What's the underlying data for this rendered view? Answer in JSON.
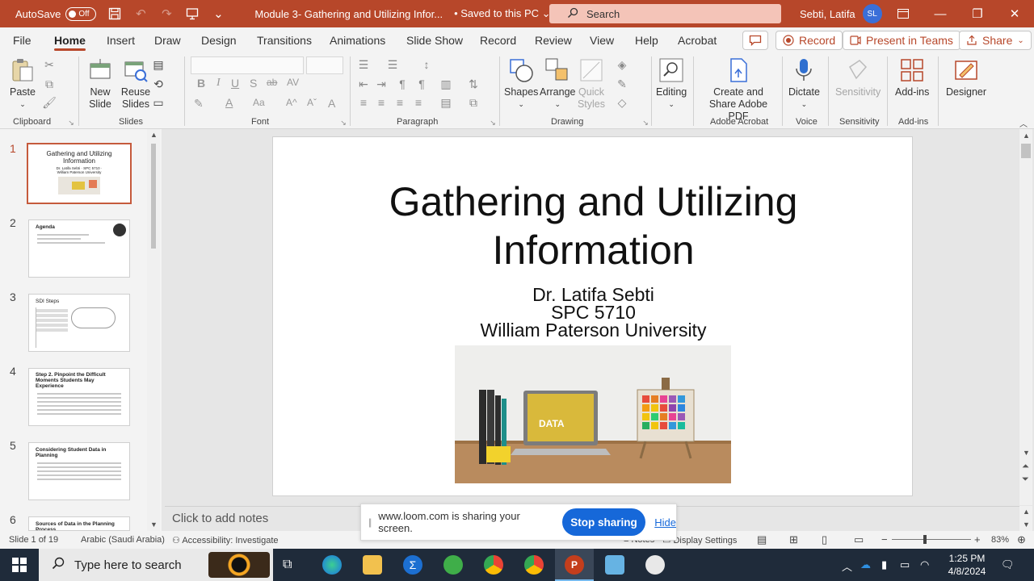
{
  "titlebar": {
    "autosave_label": "AutoSave",
    "autosave_state": "Off",
    "document_title": "Module 3- Gathering and Utilizing Infor...",
    "save_status": "• Saved to this PC",
    "search_placeholder": "Search",
    "user_name": "Sebti, Latifa",
    "user_initials": "SL"
  },
  "menu": {
    "tabs": [
      "File",
      "Home",
      "Insert",
      "Draw",
      "Design",
      "Transitions",
      "Animations",
      "Slide Show",
      "Record",
      "Review",
      "View",
      "Help",
      "Acrobat"
    ],
    "record_button": "Record",
    "present_teams_button": "Present in Teams",
    "share_button": "Share"
  },
  "ribbon": {
    "paste": "Paste",
    "new_slide": "New Slide",
    "reuse_slides": "Reuse Slides",
    "shapes": "Shapes",
    "arrange": "Arrange",
    "quick_styles": "Quick Styles",
    "editing": "Editing",
    "create_share_pdf": "Create and Share Adobe PDF",
    "dictate": "Dictate",
    "sensitivity": "Sensitivity",
    "add_ins": "Add-ins",
    "designer": "Designer",
    "groups": {
      "clipboard": "Clipboard",
      "slides": "Slides",
      "font": "Font",
      "paragraph": "Paragraph",
      "drawing": "Drawing",
      "adobe_acrobat": "Adobe Acrobat",
      "voice": "Voice",
      "sensitivity": "Sensitivity",
      "add_ins": "Add-ins"
    }
  },
  "thumbnails": [
    {
      "num": "1",
      "title": "Gathering and Utilizing Information",
      "sub": "Dr. Latifa Sebti · SPC 5710 · William Paterson University"
    },
    {
      "num": "2",
      "title": "Agenda"
    },
    {
      "num": "3",
      "title": "SDI Steps"
    },
    {
      "num": "4",
      "title": "Step 2. Pinpoint the Difficult Moments Students May Experience"
    },
    {
      "num": "5",
      "title": "Considering Student Data in Planning"
    },
    {
      "num": "6",
      "title": "Sources of Data in the Planning Process"
    }
  ],
  "slide": {
    "title_line1": "Gathering and Utilizing",
    "title_line2": "Information",
    "author": "Dr. Latifa Sebti",
    "course": "SPC 5710",
    "institution": "William Paterson University",
    "image_label": "DATA"
  },
  "notes_placeholder": "Click to add notes",
  "loom": {
    "message": "www.loom.com is sharing your screen.",
    "stop_button": "Stop sharing",
    "hide_link": "Hide"
  },
  "status": {
    "slide_counter": "Slide 1 of 19",
    "language": "Arabic (Saudi Arabia)",
    "accessibility": "Accessibility: Investigate",
    "notes": "Notes",
    "display_settings": "Display Settings",
    "zoom": "83%"
  },
  "taskbar": {
    "search_placeholder": "Type here to search",
    "time": "1:25 PM",
    "date": "4/8/2024"
  },
  "colors": {
    "accent": "#b7472a",
    "loom_blue": "#1668d9",
    "taskbar": "#1f2b3a"
  }
}
